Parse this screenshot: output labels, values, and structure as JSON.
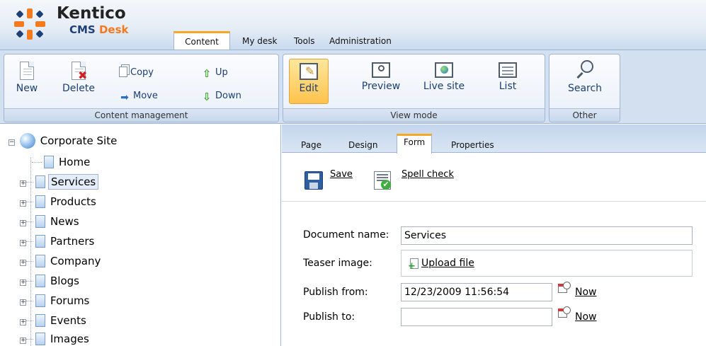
{
  "header": {
    "logo_name": "Kentico",
    "logo_cms": "CMS",
    "logo_desk": "Desk",
    "tabs": [
      {
        "label": "Content",
        "active": true
      },
      {
        "label": "My desk",
        "active": false
      },
      {
        "label": "Tools",
        "active": false
      },
      {
        "label": "Administration",
        "active": false
      }
    ]
  },
  "ribbon": {
    "content_management": {
      "label": "Content management",
      "new_label": "New",
      "delete_label": "Delete",
      "copy_label": "Copy",
      "move_label": "Move",
      "up_label": "Up",
      "down_label": "Down"
    },
    "view_mode": {
      "label": "View mode",
      "edit_label": "Edit",
      "preview_label": "Preview",
      "live_site_label": "Live site",
      "list_label": "List"
    },
    "other": {
      "label": "Other",
      "search_label": "Search"
    }
  },
  "tree": {
    "root": "Corporate Site",
    "items": [
      {
        "label": "Home",
        "expandable": false,
        "selected": false
      },
      {
        "label": "Services",
        "expandable": true,
        "selected": true
      },
      {
        "label": "Products",
        "expandable": true,
        "selected": false
      },
      {
        "label": "News",
        "expandable": true,
        "selected": false
      },
      {
        "label": "Partners",
        "expandable": true,
        "selected": false
      },
      {
        "label": "Company",
        "expandable": true,
        "selected": false
      },
      {
        "label": "Blogs",
        "expandable": true,
        "selected": false
      },
      {
        "label": "Forums",
        "expandable": true,
        "selected": false
      },
      {
        "label": "Events",
        "expandable": true,
        "selected": false
      },
      {
        "label": "Images",
        "expandable": true,
        "selected": false
      }
    ]
  },
  "content": {
    "tabs": [
      {
        "label": "Page",
        "active": false
      },
      {
        "label": "Design",
        "active": false
      },
      {
        "label": "Form",
        "active": true
      },
      {
        "label": "Properties",
        "active": false
      }
    ],
    "toolbar": {
      "save_label": "Save",
      "spellcheck_label": "Spell check"
    },
    "form": {
      "document_name_label": "Document name:",
      "document_name_value": "Services",
      "teaser_image_label": "Teaser image:",
      "upload_file_label": "Upload file",
      "publish_from_label": "Publish from:",
      "publish_from_value": "12/23/2009 11:56:54",
      "publish_to_label": "Publish to:",
      "publish_to_value": "",
      "now_label": "Now"
    }
  },
  "colors": {
    "brand_orange": "#f47a20",
    "brand_blue": "#1f3f78",
    "active_tab_accent": "#f7a823",
    "ribbon_bg": "#d3e0f0"
  }
}
